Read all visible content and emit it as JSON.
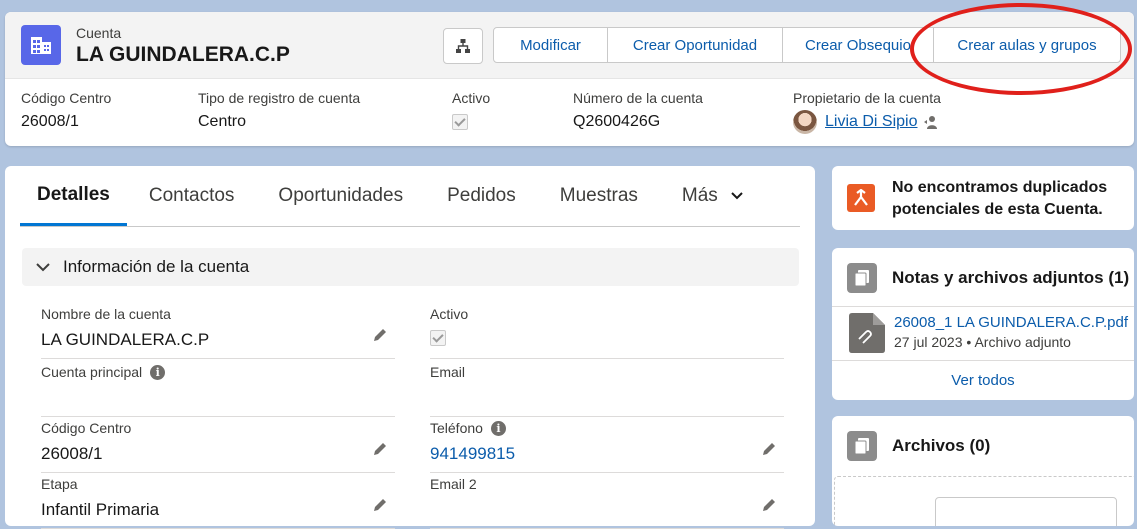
{
  "header": {
    "object_label": "Cuenta",
    "record_title": "LA GUINDALERA.C.P",
    "actions": [
      "Modificar",
      "Crear Oportunidad",
      "Crear Obsequio",
      "Crear aulas y grupos"
    ],
    "highlight_fields": [
      {
        "label": "Código Centro",
        "value": "26008/1"
      },
      {
        "label": "Tipo de registro de cuenta",
        "value": "Centro"
      },
      {
        "label": "Activo",
        "checked": true
      },
      {
        "label": "Número de la cuenta",
        "value": "Q2600426G"
      },
      {
        "label": "Propietario de la cuenta",
        "value": "Livia Di Sipio"
      }
    ],
    "highlight_color": "#e0201b"
  },
  "tabs": [
    "Detalles",
    "Contactos",
    "Oportunidades",
    "Pedidos",
    "Muestras",
    "Más"
  ],
  "section": {
    "title": "Información de la cuenta",
    "fields": [
      {
        "label": "Nombre de la cuenta",
        "value": "LA GUINDALERA.C.P",
        "editable": true
      },
      {
        "label": "Activo",
        "checked": true
      },
      {
        "label": "Cuenta principal",
        "value": "",
        "info": true
      },
      {
        "label": "Email",
        "value": ""
      },
      {
        "label": "Código Centro",
        "value": "26008/1",
        "editable": true
      },
      {
        "label": "Teléfono",
        "value": "941499815",
        "info": true,
        "editable": true
      },
      {
        "label": "Etapa",
        "value": "Infantil Primaria",
        "editable": true
      },
      {
        "label": "Email 2",
        "value": "",
        "editable": true
      }
    ]
  },
  "sidebar": {
    "duplicates_text_1": "No encontramos duplicados",
    "duplicates_text_2": "potenciales de esta Cuenta.",
    "notes_title": "Notas y archivos adjuntos (1)",
    "note_file_name": "26008_1 LA GUINDALERA.C.P.pdf",
    "note_file_date": "27 jul 2023",
    "note_file_type": "Archivo adjunto",
    "view_all": "Ver todos",
    "files_title": "Archivos (0)"
  },
  "colors": {
    "brand_link": "#0b5cab",
    "tab_active": "#0176d3",
    "account_icon": "#5867e8",
    "dup_icon": "#ea5b25"
  },
  "icons": [
    "account-icon",
    "hierarchy-icon",
    "chevron-down-icon",
    "pencil-icon",
    "info-icon",
    "duplicate-icon",
    "notes-icon",
    "attachment-icon",
    "files-icon",
    "change-owner-icon"
  ]
}
